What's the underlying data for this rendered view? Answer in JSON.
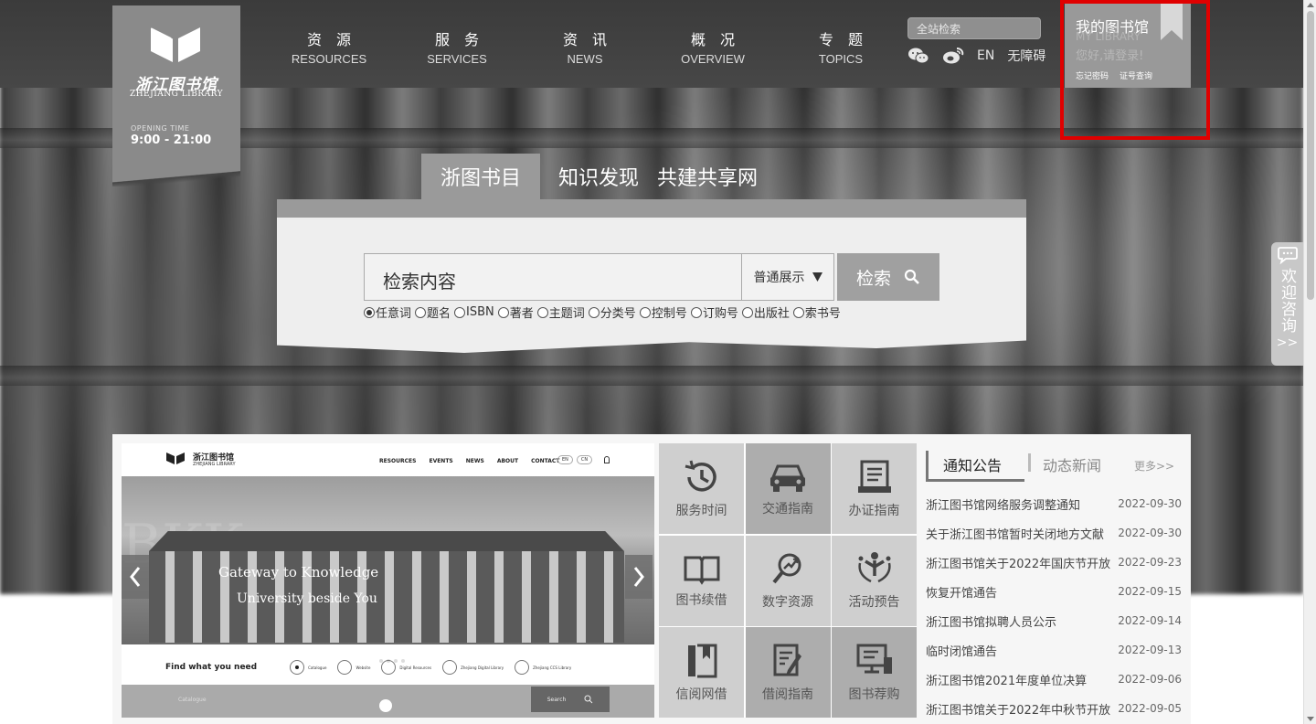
{
  "logo": {
    "cn": "浙江图书馆",
    "en": "ZHEJIANG LIBRARY",
    "opening_label": "OPENING TIME",
    "opening_time": "9:00 - 21:00"
  },
  "nav": [
    {
      "cn": "资源",
      "en": "RESOURCES"
    },
    {
      "cn": "服务",
      "en": "SERVICES"
    },
    {
      "cn": "资讯",
      "en": "NEWS"
    },
    {
      "cn": "概况",
      "en": "OVERVIEW"
    },
    {
      "cn": "专题",
      "en": "TOPICS"
    }
  ],
  "site_search": {
    "placeholder": "全站检索"
  },
  "top_links": {
    "en": "EN",
    "accessibility": "无障碍"
  },
  "mylib": {
    "title": "我的图书馆",
    "en": "MY LIBRARY",
    "hello": "您好,请登录!",
    "forgot": "忘记密码",
    "card_query": "证号查询"
  },
  "search": {
    "tabs": [
      "浙图书目",
      "知识发现",
      "共建共享网"
    ],
    "input_value": "检索内容",
    "display_mode": "普通展示",
    "button": "检索",
    "fields": [
      "任意词",
      "题名",
      "ISBN",
      "著者",
      "主题词",
      "分类号",
      "控制号",
      "订购号",
      "出版社",
      "索书号"
    ],
    "selected_field": "任意词"
  },
  "slide": {
    "logo_cn": "浙江图书馆",
    "logo_en": "ZHEJIANG LIBRARY",
    "nav": [
      "RESOURCES",
      "EVENTS",
      "NEWS",
      "ABOUT",
      "CONTACT"
    ],
    "lang": [
      "EN",
      "CN"
    ],
    "bigtext": "BKK",
    "caption1": "Gateway to Knowledge",
    "caption2": "University beside You",
    "find_label": "Find what you need",
    "find_options": [
      "Catalogue",
      "Website",
      "Digital Resources",
      "Zhejiang Digital Library",
      "Zhejiang CCS Library"
    ],
    "catalog_placeholder": "Catalogue",
    "search_btn": "Search"
  },
  "quick_links": [
    {
      "label": "服务时间",
      "icon": "clock-icon"
    },
    {
      "label": "交通指南",
      "icon": "car-icon"
    },
    {
      "label": "办证指南",
      "icon": "card-icon"
    },
    {
      "label": "图书续借",
      "icon": "book-icon"
    },
    {
      "label": "数字资源",
      "icon": "magnifier-chart-icon"
    },
    {
      "label": "活动预告",
      "icon": "people-icon"
    },
    {
      "label": "信阅网借",
      "icon": "bookmark-book-icon"
    },
    {
      "label": "借阅指南",
      "icon": "document-pen-icon"
    },
    {
      "label": "图书荐购",
      "icon": "computer-icon"
    }
  ],
  "news": {
    "tab_active": "通知公告",
    "tab_other": "动态新闻",
    "more": "更多>>",
    "items": [
      {
        "title": "浙江图书馆网络服务调整通知",
        "date": "2022-09-30"
      },
      {
        "title": "关于浙江图书馆暂时关闭地方文献",
        "date": "2022-09-30"
      },
      {
        "title": "浙江图书馆关于2022年国庆节开放",
        "date": "2022-09-23"
      },
      {
        "title": "恢复开馆通告",
        "date": "2022-09-15"
      },
      {
        "title": "浙江图书馆拟聘人员公示",
        "date": "2022-09-14"
      },
      {
        "title": "临时闭馆通告",
        "date": "2022-09-13"
      },
      {
        "title": "浙江图书馆2021年度单位决算",
        "date": "2022-09-06"
      },
      {
        "title": "浙江图书馆关于2022年中秋节开放",
        "date": "2022-09-05"
      }
    ]
  },
  "consult": {
    "label": "欢迎咨询",
    "arrow": ">>"
  }
}
